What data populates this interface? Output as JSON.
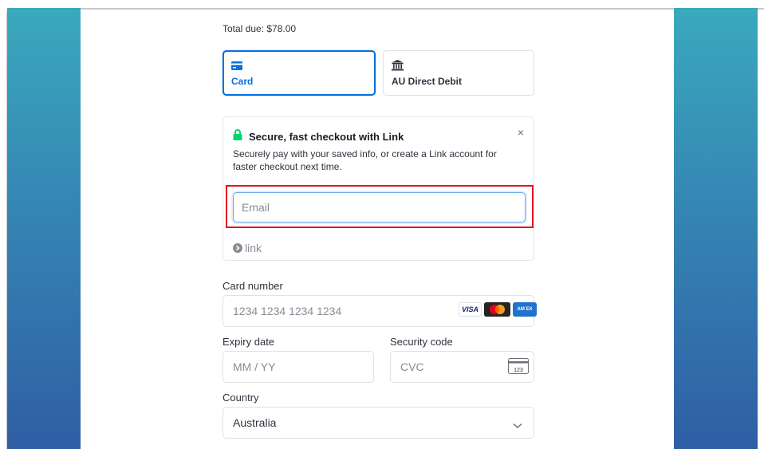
{
  "checkout": {
    "total_due": "Total due: $78.00"
  },
  "payment_tabs": [
    {
      "label": "Card",
      "icon": "card-icon",
      "selected": true
    },
    {
      "label": "AU Direct Debit",
      "icon": "bank-icon",
      "selected": false
    }
  ],
  "link_panel": {
    "title": "Secure, fast checkout with Link",
    "description": "Securely pay with your saved info, or create a Link account for faster checkout next time.",
    "close_glyph": "×",
    "email_placeholder": "Email",
    "email_value": "",
    "logo_text": "link"
  },
  "card_form": {
    "card_number_label": "Card number",
    "card_number_placeholder": "1234 1234 1234 1234",
    "expiry_label": "Expiry date",
    "expiry_placeholder": "MM / YY",
    "security_label": "Security code",
    "security_placeholder": "CVC",
    "cvc_icon_text": "123",
    "brands": [
      {
        "name": "visa",
        "text": "VISA"
      },
      {
        "name": "mastercard",
        "text": ""
      },
      {
        "name": "amex",
        "text": "AM EX"
      }
    ]
  },
  "country": {
    "label": "Country",
    "value": "Australia"
  },
  "colors": {
    "accent": "#0570de",
    "highlight": "#e0191e",
    "link_green": "#00d66f",
    "side_gradient_top": "#3aa9bd",
    "side_gradient_bottom": "#2f5ea4"
  }
}
